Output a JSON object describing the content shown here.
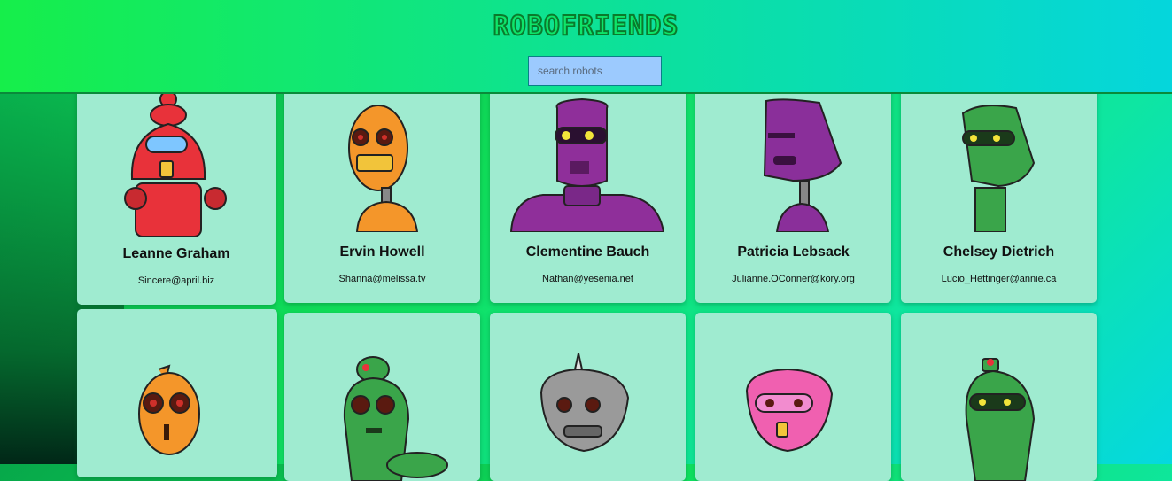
{
  "header": {
    "title": "ROBOFRIENDS",
    "search_placeholder": "search robots"
  },
  "robots": [
    {
      "name": "Leanne Graham",
      "email": "Sincere@april.biz",
      "color": "#e8323a",
      "icon": "red-robot-avatar"
    },
    {
      "name": "Ervin Howell",
      "email": "Shanna@melissa.tv",
      "color": "#f4962a",
      "icon": "orange-robot-avatar"
    },
    {
      "name": "Clementine Bauch",
      "email": "Nathan@yesenia.net",
      "color": "#8f2f9a",
      "icon": "purple-robot-avatar"
    },
    {
      "name": "Patricia Lebsack",
      "email": "Julianne.OConner@kory.org",
      "color": "#8a2f9a",
      "icon": "purple-robot-avatar"
    },
    {
      "name": "Chelsey Dietrich",
      "email": "Lucio_Hettinger@annie.ca",
      "color": "#3aa54a",
      "icon": "green-robot-avatar"
    },
    {
      "name": "",
      "email": "",
      "color": "#f4962a",
      "icon": "orange-robot-avatar"
    },
    {
      "name": "",
      "email": "",
      "color": "#3aa54a",
      "icon": "green-robot-avatar"
    },
    {
      "name": "",
      "email": "",
      "color": "#9a9a9a",
      "icon": "gray-robot-avatar"
    },
    {
      "name": "",
      "email": "",
      "color": "#f060b0",
      "icon": "pink-robot-avatar"
    },
    {
      "name": "",
      "email": "",
      "color": "#3aa54a",
      "icon": "green-robot-avatar"
    }
  ]
}
